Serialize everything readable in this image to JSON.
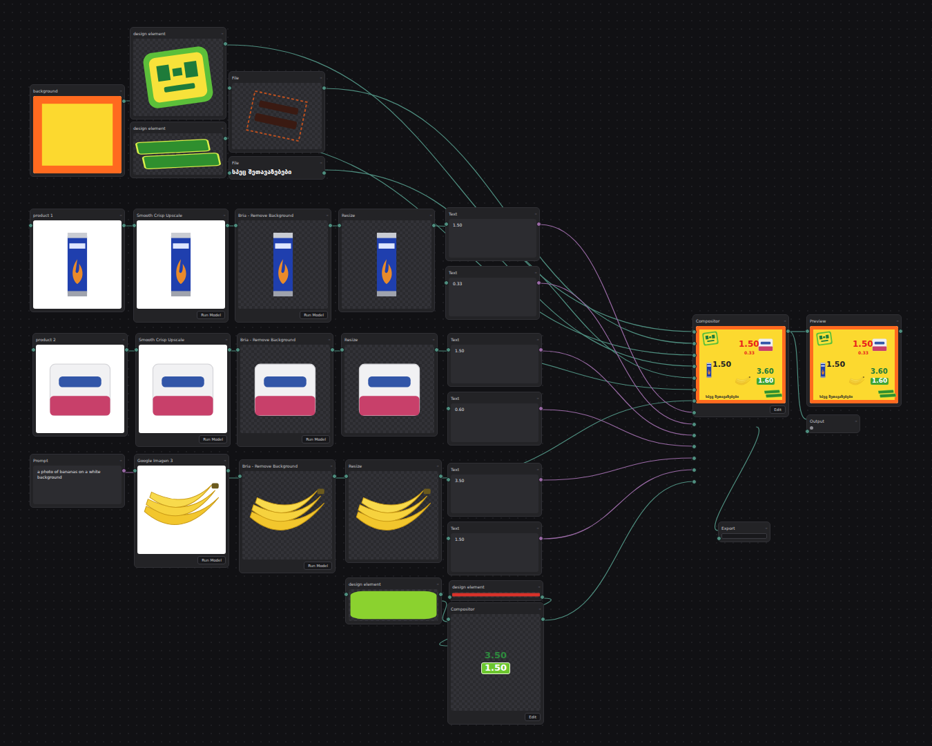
{
  "canvas": {
    "menu": "···",
    "nodes": [
      {
        "title": "background",
        "kind": "background",
        "transparent": false
      },
      {
        "title": "design element",
        "kind": "badge",
        "transparent": true
      },
      {
        "title": "File",
        "kind": "stamp",
        "transparent": true
      },
      {
        "title": "design element",
        "kind": "slogan",
        "transparent": true
      },
      {
        "title": "File",
        "kind": "label",
        "text": "სპეც შეთავაზებები"
      },
      {
        "title": "product 1",
        "kind": "can",
        "transparent": false
      },
      {
        "title": "Smooth Crisp Upscale",
        "kind": "can",
        "transparent": false,
        "button": "Run Model"
      },
      {
        "title": "Bria - Remove Background",
        "kind": "can",
        "transparent": true,
        "button": "Run Model"
      },
      {
        "title": "Resize",
        "kind": "can",
        "transparent": true
      },
      {
        "title": "Text",
        "kind": "text",
        "value": "1.50"
      },
      {
        "title": "Text",
        "kind": "text",
        "value": "0.33"
      },
      {
        "title": "Text",
        "kind": "text",
        "value": "1.50"
      },
      {
        "title": "Text",
        "kind": "text",
        "value": "0.60"
      },
      {
        "title": "Text",
        "kind": "text",
        "value": "3.50"
      },
      {
        "title": "Text",
        "kind": "text",
        "value": "1.50"
      },
      {
        "title": "product 2",
        "kind": "napkin",
        "transparent": false
      },
      {
        "title": "Smooth Crisp Upscale",
        "kind": "napkin",
        "transparent": false,
        "button": "Run Model"
      },
      {
        "title": "Bria - Remove Background",
        "kind": "napkin",
        "transparent": true,
        "button": "Run Model"
      },
      {
        "title": "Resize",
        "kind": "napkin",
        "transparent": true
      },
      {
        "title": "Prompt",
        "kind": "prompt",
        "text": "a photo of bananas on a white background"
      },
      {
        "title": "Google Imagen 3",
        "kind": "bananas",
        "transparent": false,
        "button": "Run Model"
      },
      {
        "title": "Bria - Remove Background",
        "kind": "bananas",
        "transparent": true,
        "button": "Run Model"
      },
      {
        "title": "Resize",
        "kind": "bananas",
        "transparent": true
      },
      {
        "title": "design element",
        "kind": "pill",
        "transparent": true
      },
      {
        "title": "design element",
        "kind": "line",
        "transparent": true
      },
      {
        "title": "Compositor",
        "kind": "compositor",
        "button": "Edit",
        "prices": [
          {
            "text": "3.50",
            "boxed": false
          },
          {
            "text": "1.50",
            "boxed": true
          }
        ]
      },
      {
        "title": "Compositor",
        "kind": "poster",
        "button": "Edit"
      },
      {
        "title": "Preview",
        "kind": "poster"
      },
      {
        "title": "Output",
        "kind": "output"
      },
      {
        "title": "Export",
        "kind": "export"
      }
    ]
  },
  "poster": {
    "footer": "სპეც შეთავაზებები",
    "prices": [
      {
        "text": "1.50",
        "color": "#e8231c",
        "boxed": false
      },
      {
        "text": "0.33",
        "color": "#e8231c",
        "boxed": false
      },
      {
        "text": "1.50",
        "color": "#222222",
        "boxed": false
      },
      {
        "text": "3.60",
        "color": "#1e7b3a",
        "boxed": false
      },
      {
        "text": "1.60",
        "color": "#ffffff",
        "boxed": true
      }
    ]
  }
}
